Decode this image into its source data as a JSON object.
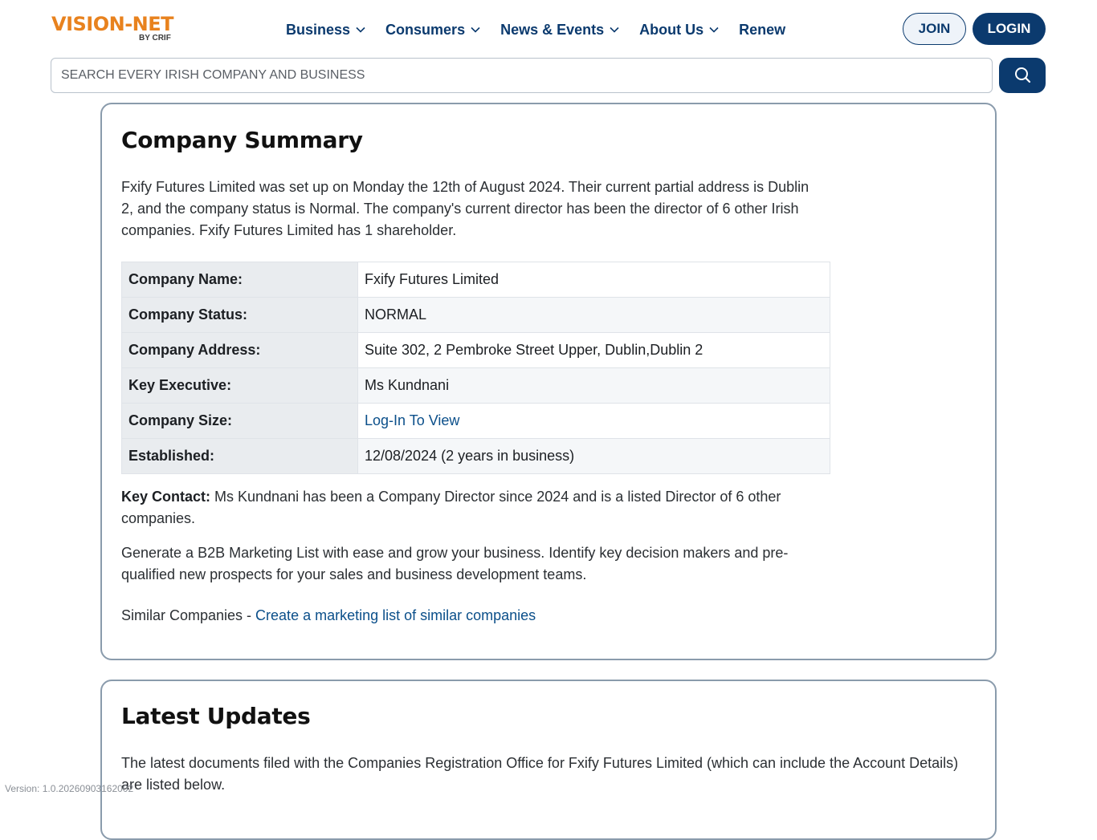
{
  "header": {
    "logo_text": "VISION-NET",
    "logo_sub": "BY CRIF",
    "nav": [
      {
        "label": "Business",
        "has_dropdown": true
      },
      {
        "label": "Consumers",
        "has_dropdown": true
      },
      {
        "label": "News & Events",
        "has_dropdown": true
      },
      {
        "label": "About Us",
        "has_dropdown": true
      },
      {
        "label": "Renew",
        "has_dropdown": false
      }
    ],
    "join_label": "JOIN",
    "login_label": "LOGIN"
  },
  "search": {
    "placeholder": "SEARCH EVERY IRISH COMPANY AND BUSINESS",
    "button_icon": "search-icon"
  },
  "summary": {
    "title": "Company Summary",
    "intro": "Fxify Futures Limited was set up on Monday the 12th of August 2024. Their current partial address is Dublin 2, and the company status is Normal. The company's current director has been the director of 6 other Irish companies. Fxify Futures Limited has 1 shareholder.",
    "rows": [
      {
        "label": "Company Name:",
        "value": "Fxify Futures Limited"
      },
      {
        "label": "Company Status:",
        "value": "NORMAL"
      },
      {
        "label": "Company Address:",
        "value": "Suite 302, 2 Pembroke Street Upper, Dublin,Dublin 2"
      },
      {
        "label": "Key Executive:",
        "value": "Ms Kundnani"
      },
      {
        "label": "Company Size:",
        "value": "Log-In To View"
      },
      {
        "label": "Established:",
        "value": "12/08/2024 (2 years in business)"
      }
    ],
    "key_contact_label": "Key Contact:",
    "key_contact_text": " Ms Kundnani has been a Company Director since 2024 and is a listed Director of 6 other companies.",
    "marketing_text": "Generate a B2B Marketing List with ease and grow your business. Identify key decision makers and pre-qualified new prospects for your sales and business development teams.",
    "similar_prefix": "Similar Companies - ",
    "similar_link": "Create a marketing list of similar companies"
  },
  "updates": {
    "title": "Latest Updates",
    "text": "The latest documents filed with the Companies Registration Office for Fxify Futures Limited (which can include the Account Details) are listed below."
  },
  "footer": {
    "version": "Version: 1.0.20260903162002"
  },
  "colors": {
    "brand_orange": "#e8821e",
    "brand_navy": "#0b3a6e",
    "link": "#0b4f8a"
  }
}
